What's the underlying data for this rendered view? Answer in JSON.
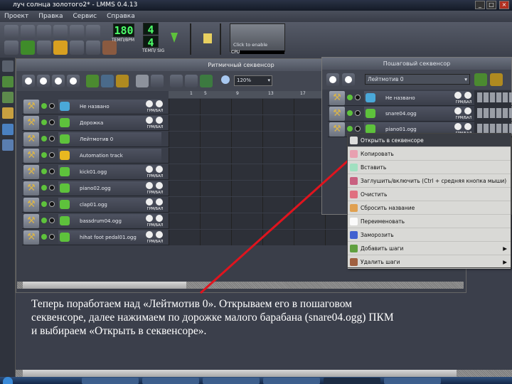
{
  "window": {
    "title": "луч солнца золотого2* - LMMS 0.4.13",
    "controls": [
      "_",
      "□",
      "×"
    ]
  },
  "menu": [
    "Проект",
    "Правка",
    "Сервис",
    "Справка"
  ],
  "toolbar": {
    "tempo": "180",
    "tempo_label": "ТЕМП/BPM",
    "sig_num": "4",
    "sig_den": "4",
    "sig_label": "ТЕМП/ SIG",
    "cpu_hint": "Click to enable",
    "cpu_label": "CPU"
  },
  "song_editor": {
    "title": "Ритмичный секвенсор",
    "zoom": "120%",
    "timeline": [
      "1",
      "5",
      "9",
      "13",
      "17"
    ],
    "tracks": [
      {
        "name": "Не названо",
        "type": "instrument",
        "color": "#4aa8d8",
        "knob_label": "ГРМ/БАЛ"
      },
      {
        "name": "Дорожка",
        "type": "bb",
        "color": "#5ec23c",
        "knob_label": "ГРМ/БАЛ"
      },
      {
        "name": "Лейтмотив 0",
        "type": "bb",
        "color": "#5ec23c",
        "knob_label": ""
      },
      {
        "name": "Automation track",
        "type": "automation",
        "color": "#e8b820",
        "knob_label": ""
      },
      {
        "name": "kick01.ogg",
        "type": "sample",
        "color": "#5ec23c",
        "knob_label": "ГРМ/БАЛ"
      },
      {
        "name": "piano02.ogg",
        "type": "sample",
        "color": "#5ec23c",
        "knob_label": "ГРМ/БАЛ"
      },
      {
        "name": "clap01.ogg",
        "type": "sample",
        "color": "#5ec23c",
        "knob_label": "ГРМ/БАЛ"
      },
      {
        "name": "bassdrum04.ogg",
        "type": "sample",
        "color": "#5ec23c",
        "knob_label": "ГРМ/БАЛ"
      },
      {
        "name": "hihat foot pedal01.ogg",
        "type": "sample",
        "color": "#5ec23c",
        "knob_label": "ГРМ/БАЛ"
      }
    ]
  },
  "step_sequencer": {
    "title": "Пошаговый секвенсор",
    "pattern": "Лейтмотив 0",
    "tracks": [
      {
        "name": "Не названо",
        "color": "#4aa8d8",
        "knob_label": "ГРМ/БАЛ"
      },
      {
        "name": "snare04.ogg",
        "color": "#5ec23c",
        "knob_label": "ГРМ/БАЛ"
      },
      {
        "name": "piano01.ogg",
        "color": "#5ec23c",
        "knob_label": "ГРМ/БАЛ"
      }
    ]
  },
  "context_menu": [
    {
      "label": "Открыть в секвенсоре",
      "icon": "piano-roll-icon",
      "color": "#ddd",
      "highlighted": true
    },
    {
      "label": "Копировать",
      "icon": "copy-icon",
      "color": "#e8a0b0"
    },
    {
      "label": "Вставить",
      "icon": "paste-icon",
      "color": "#a0e0c0"
    },
    {
      "label": "Заглушить/включить (Ctrl + средняя кнопка мыши)",
      "icon": "mute-icon",
      "color": "#c86080"
    },
    {
      "label": "Очистить",
      "icon": "clear-icon",
      "color": "#e07080"
    },
    {
      "label": "Сбросить название",
      "icon": "reset-name-icon",
      "color": "#e0a050"
    },
    {
      "label": "Переименовать",
      "icon": "rename-icon",
      "color": "#fafafa"
    },
    {
      "label": "Заморозить",
      "icon": "freeze-icon",
      "color": "#4060d0"
    },
    {
      "label": "Добавить шаги",
      "icon": "add-steps-icon",
      "color": "#60a040",
      "submenu": true
    },
    {
      "label": "Удалить шаги",
      "icon": "remove-steps-icon",
      "color": "#a06040",
      "submenu": true
    }
  ],
  "caption": "Теперь поработаем над «Лейтмотив 0». Открываем его в пошаговом секвенсоре, далее нажимаем по дорожке малого барабана (snare04.ogg) ПКМ и выбираем «Открыть в секвенсоре».",
  "colors": {
    "arrow": "#e0141e",
    "lcd": "#4dff6a"
  }
}
